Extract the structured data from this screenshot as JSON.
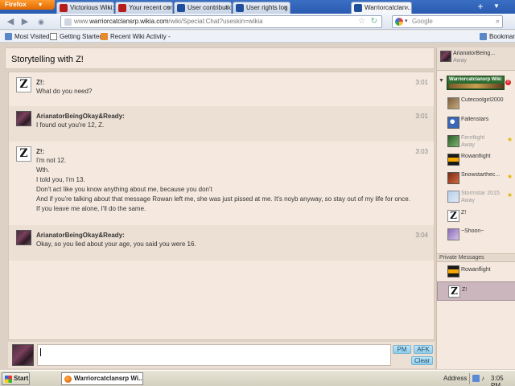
{
  "browser": {
    "menu_label": "Firefox",
    "tabs": [
      {
        "label": "Victorious Wiki: W...",
        "color": "#b71c1c"
      },
      {
        "label": "Your recent comm...",
        "color": "#b71c1c"
      },
      {
        "label": "User contributions...",
        "color": "#1f4f9c"
      },
      {
        "label": "User rights log",
        "color": "#1f4f9c"
      },
      {
        "label": "Warriorcatclan...",
        "color": "#1f4f9c"
      }
    ],
    "url_prefix": "www.",
    "url_domain": "warriorcatclansrp.wikia.com",
    "url_path": "/wiki/Special:Chat?useskin=wikia",
    "search_placeholder": "Google",
    "bookmarks": [
      {
        "label": "Most Visited"
      },
      {
        "label": "Getting Started"
      },
      {
        "label": "Recent Wiki Activity -"
      }
    ],
    "bookmarks_menu": "Bookmarks"
  },
  "chat": {
    "room_title": "Storytelling with Z!",
    "messages": [
      {
        "user": "Z!:",
        "time": "3:01",
        "lines": [
          "What do you need?"
        ]
      },
      {
        "user": "ArianatorBeingOkay&Ready:",
        "time": "3:01",
        "lines": [
          "I found out you're 12, Z."
        ]
      },
      {
        "user": "Z!:",
        "time": "3:03",
        "lines": [
          "I'm not 12.",
          "Wth.",
          "I told you, I'm 13.",
          "Don't act like you know anything about me, because you don't",
          "And if you're talking about that message Rowan left me, she was just pissed at me. It's noyb anyway, so stay out of my life for once.",
          "If you leave me alone, I'll do the same."
        ]
      },
      {
        "user": "ArianatorBeingOkay&Ready:",
        "time": "3:04",
        "lines": [
          "Okay, so you lied about your age, you said you were 16."
        ]
      }
    ],
    "input_value": "",
    "buttons": {
      "pm": "PM",
      "afk": "AFK",
      "clear": "Clear"
    }
  },
  "sidebar": {
    "self": {
      "name": "ArianatorBeing...",
      "status": "Away"
    },
    "wiki_banner": "Warriorcatclansrp Wiki",
    "badge": "0",
    "users": [
      {
        "name": "Cutecoolgirl2000",
        "status": "",
        "avatar": "a-cute",
        "fav": false
      },
      {
        "name": "Fallenstars",
        "status": "",
        "avatar": "a-fallen",
        "fav": false
      },
      {
        "name": "Fernflight",
        "status": "Away",
        "avatar": "a-fern",
        "fav": true
      },
      {
        "name": "Rowanflight",
        "status": "",
        "avatar": "a-rowan",
        "fav": false
      },
      {
        "name": "Snowstarthec...",
        "status": "",
        "avatar": "a-snow",
        "fav": true
      },
      {
        "name": "Stormstar 2015",
        "status": "Away",
        "avatar": "a-storm",
        "fav": true
      },
      {
        "name": "Z!",
        "status": "",
        "avatar": "a-z",
        "fav": false
      },
      {
        "name": "~Shoon~",
        "status": "",
        "avatar": "a-shoon",
        "fav": false
      }
    ],
    "private_header": "Private Messages",
    "private": [
      {
        "name": "Rowanflight",
        "avatar": "a-rowan"
      },
      {
        "name": "Z!",
        "avatar": "a-z"
      }
    ]
  },
  "taskbar": {
    "start": "Start",
    "window": "Warriorcatclansrp Wi...",
    "address": "Address",
    "clock": "3:05 PM"
  }
}
